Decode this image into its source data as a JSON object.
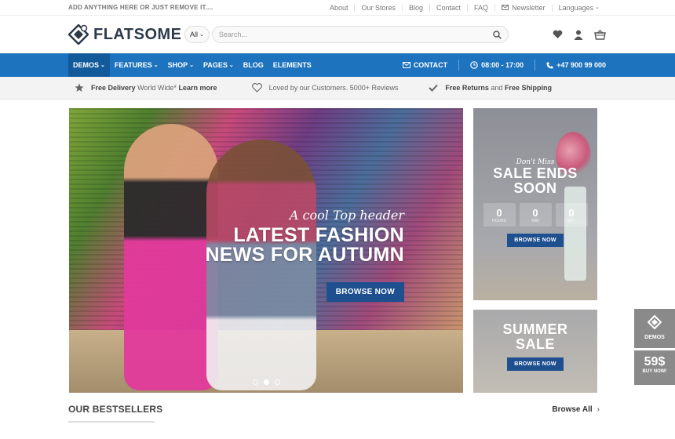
{
  "topbar": {
    "promo": "ADD ANYTHING HERE OR JUST REMOVE IT....",
    "links": [
      "About",
      "Our Stores",
      "Blog",
      "Contact",
      "FAQ"
    ],
    "newsletter": "Newsletter",
    "languages": "Languages"
  },
  "header": {
    "logo": "FLATSOME",
    "search_category": "All",
    "search_placeholder": "Search..."
  },
  "nav": {
    "items": [
      {
        "label": "DEMOS",
        "active": true,
        "dropdown": true
      },
      {
        "label": "FEATURES",
        "dropdown": true
      },
      {
        "label": "SHOP",
        "dropdown": true
      },
      {
        "label": "PAGES",
        "dropdown": true
      },
      {
        "label": "BLOG",
        "dropdown": false
      },
      {
        "label": "ELEMENTS",
        "dropdown": false
      }
    ],
    "contact": "CONTACT",
    "hours": "08:00 - 17:00",
    "phone": "+47 900 99 000",
    "color": "#1e73be"
  },
  "features": [
    {
      "icon": "star-icon",
      "bold": "Free Delivery",
      "text": "World Wide*",
      "link": "Learn more"
    },
    {
      "icon": "heart-outline-icon",
      "text": "Loved by our Customers. 5000+ Reviews"
    },
    {
      "icon": "checkmark-icon",
      "bold": "Free Returns",
      "text": "and",
      "bold2": "Free Shipping"
    }
  ],
  "hero": {
    "tagline": "A cool Top header",
    "title_line1": "LATEST FASHION",
    "title_line2": "NEWS FOR AUTUMN",
    "button": "BROWSE NOW",
    "slides": 3,
    "active_slide": 2
  },
  "sale_banner": {
    "script": "Don't Miss",
    "title_line1": "SALE ENDS",
    "title_line2": "SOON",
    "countdown": [
      {
        "value": "0",
        "unit": "HOURS"
      },
      {
        "value": "0",
        "unit": "MIN"
      },
      {
        "value": "0",
        "unit": "SEC"
      }
    ],
    "button": "BROWSE NOW"
  },
  "summer_banner": {
    "title_line1": "SUMMER",
    "title_line2": "SALE",
    "button": "BROWSE NOW"
  },
  "floating": {
    "demos": "DEMOS",
    "price": "59$",
    "buy": "BUY NOW!"
  },
  "bestsellers": {
    "title": "OUR BESTSELLERS",
    "browse_all": "Browse All"
  }
}
